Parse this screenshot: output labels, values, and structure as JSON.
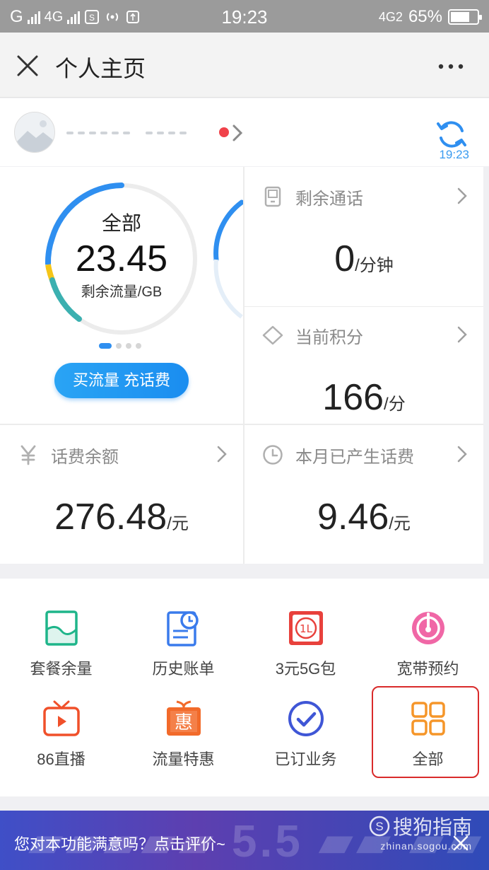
{
  "status_bar": {
    "carrier_left": "G",
    "network": "4G",
    "time": "19:23",
    "network_right": "4G2",
    "battery": "65%"
  },
  "nav": {
    "title": "个人主页"
  },
  "user": {
    "refresh_time": "19:23"
  },
  "flow_card": {
    "label": "全部",
    "value": "23.45",
    "unit": "剩余流量/GB",
    "button": "买流量 充话费"
  },
  "call_card": {
    "title": "剩余通话",
    "value": "0",
    "unit": "/分钟"
  },
  "points_card": {
    "title": "当前积分",
    "value": "166",
    "unit": "/分"
  },
  "balance_card": {
    "title": "话费余额",
    "value": "276.48",
    "unit": "/元"
  },
  "month_card": {
    "title": "本月已产生话费",
    "value": "9.46",
    "unit": "/元"
  },
  "services": [
    {
      "label": "套餐余量",
      "icon": "package-icon"
    },
    {
      "label": "历史账单",
      "icon": "bill-history-icon"
    },
    {
      "label": "3元5G包",
      "icon": "5g-package-icon"
    },
    {
      "label": "宽带预约",
      "icon": "broadband-icon"
    },
    {
      "label": "86直播",
      "icon": "tv-live-icon"
    },
    {
      "label": "流量特惠",
      "icon": "gift-icon"
    },
    {
      "label": "已订业务",
      "icon": "check-circle-icon"
    },
    {
      "label": "全部",
      "icon": "grid-icon"
    }
  ],
  "banner": {
    "text": "您对本功能满意吗？点击评价~",
    "watermark_main": "搜狗指南",
    "watermark_sub": "zhinan.sogou.com"
  },
  "colors": {
    "accent_blue": "#2f8ff0",
    "ring_teal": "#3bb0b0",
    "ring_yellow": "#f5c518",
    "highlight_red": "#d92b2b"
  }
}
